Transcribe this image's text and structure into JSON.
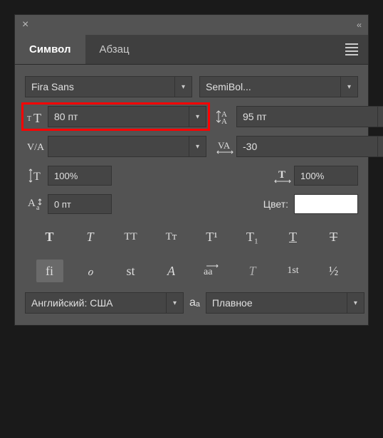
{
  "titlebar": {
    "close": "×",
    "collapse": "‹‹"
  },
  "tabs": {
    "character": "Символ",
    "paragraph": "Абзац"
  },
  "fontFamily": {
    "value": "Fira Sans"
  },
  "fontStyle": {
    "value": "SemiBol..."
  },
  "fontSize": {
    "value": "80 пт"
  },
  "leading": {
    "value": "95 пт"
  },
  "va": {
    "value": ""
  },
  "tracking": {
    "value": "-30"
  },
  "vScale": {
    "value": "100%"
  },
  "hScale": {
    "value": "100%"
  },
  "baseline": {
    "value": "0 пт"
  },
  "colorLabel": "Цвет:",
  "colorValue": "#ffffff",
  "styleRow1": {
    "bold": "T",
    "italic": "T",
    "allCaps": "TT",
    "smallCaps": "Tᴛ",
    "sup": "T¹",
    "sub": "T₁",
    "underline": "T",
    "strike": "T"
  },
  "styleRow2": {
    "lig": "fi",
    "swash": "ℴ",
    "stylistic": "st",
    "titling": "A",
    "contextual": "aa",
    "vert": "T",
    "ordinals": "1st",
    "fractions": "½"
  },
  "language": {
    "value": "Английский: США"
  },
  "aaIcon": "aₐ",
  "antialias": {
    "value": "Плавное"
  }
}
